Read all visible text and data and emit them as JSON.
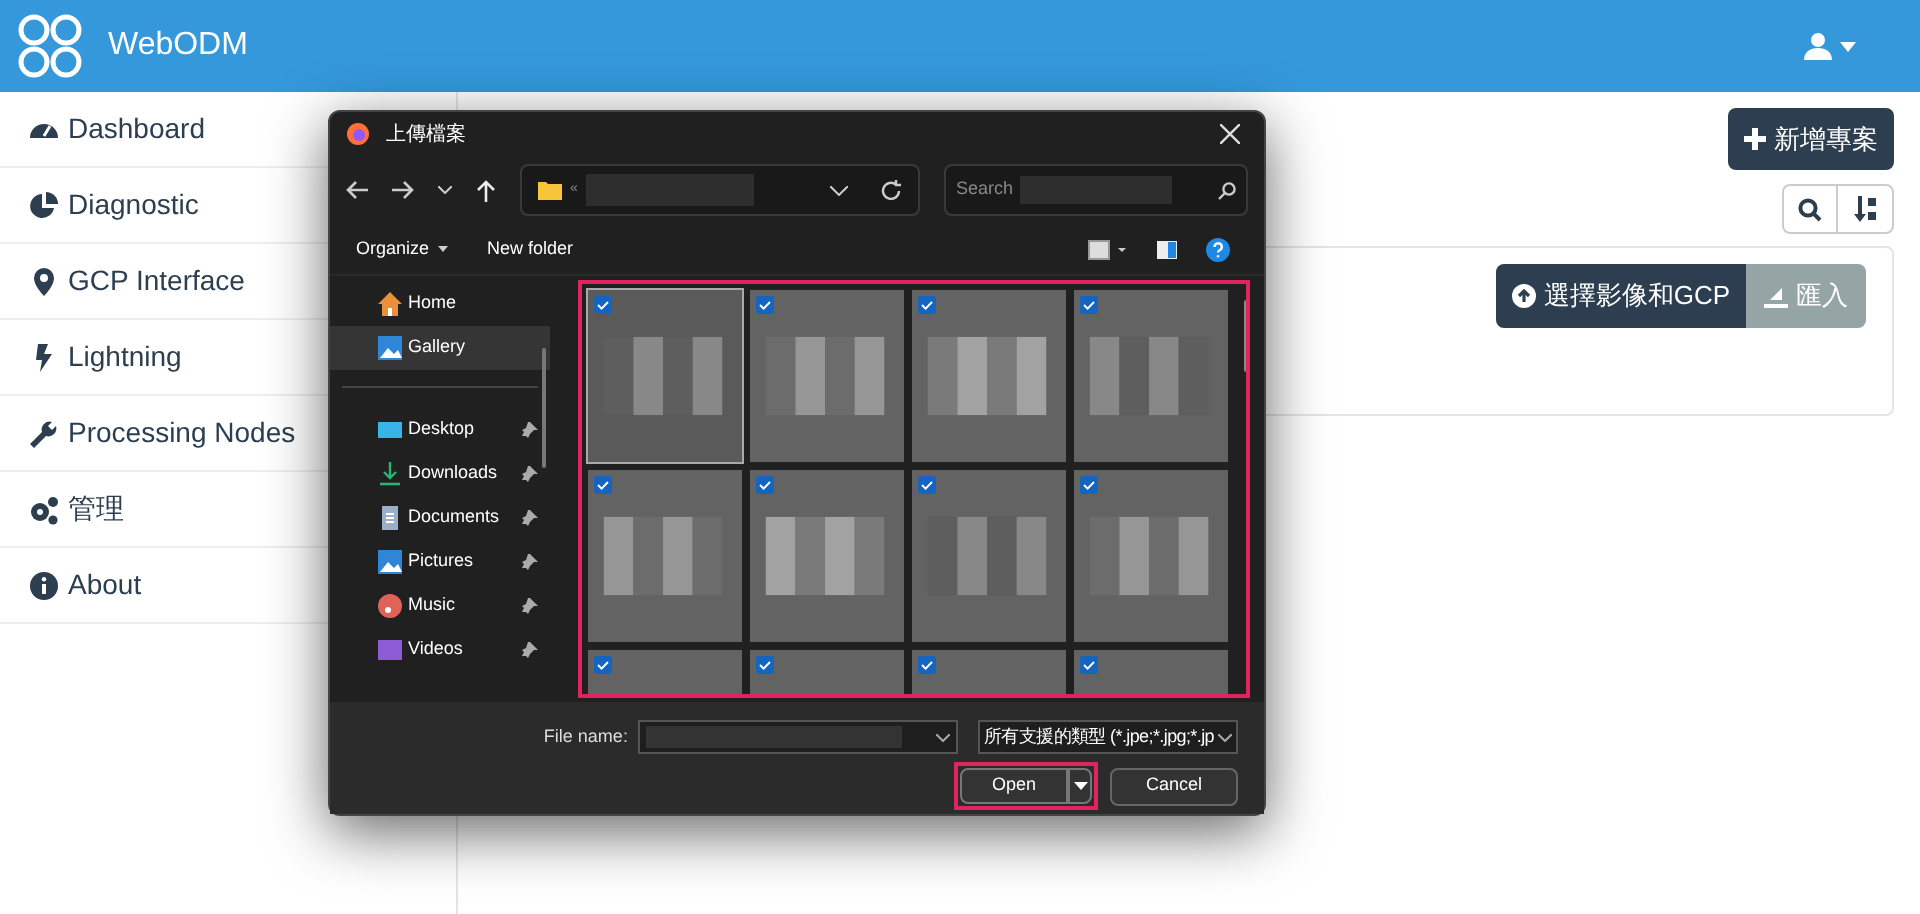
{
  "app": {
    "title": "WebODM"
  },
  "sidebar": {
    "items": [
      {
        "label": "Dashboard",
        "kind": "dashboard"
      },
      {
        "label": "Diagnostic",
        "kind": "pie"
      },
      {
        "label": "GCP Interface",
        "kind": "pin"
      },
      {
        "label": "Lightning",
        "kind": "bolt"
      },
      {
        "label": "Processing Nodes",
        "kind": "wrench"
      },
      {
        "label": "管理",
        "kind": "gears"
      },
      {
        "label": "About",
        "kind": "info"
      }
    ]
  },
  "toolbar": {
    "new_project": "新增專案"
  },
  "project": {
    "select_button": "選擇影像和GCP",
    "import_button": "匯入"
  },
  "dialog": {
    "title": "上傳檔案",
    "address_prefix": "«",
    "search_placeholder": "Search",
    "organize": "Organize",
    "new_folder": "New folder",
    "nav": [
      {
        "label": "Home",
        "kind": "home",
        "selected": false,
        "pinned": false
      },
      {
        "label": "Gallery",
        "kind": "gallery",
        "selected": true,
        "pinned": false
      },
      {
        "kind": "divider"
      },
      {
        "label": "Desktop",
        "kind": "desktop",
        "selected": false,
        "pinned": true
      },
      {
        "label": "Downloads",
        "kind": "download",
        "selected": false,
        "pinned": true
      },
      {
        "label": "Documents",
        "kind": "documents",
        "selected": false,
        "pinned": true
      },
      {
        "label": "Pictures",
        "kind": "pictures",
        "selected": false,
        "pinned": true
      },
      {
        "label": "Music",
        "kind": "music",
        "selected": false,
        "pinned": true
      },
      {
        "label": "Videos",
        "kind": "videos",
        "selected": false,
        "pinned": true
      }
    ],
    "thumbnails": [
      {
        "checked": true,
        "selected": true
      },
      {
        "checked": true,
        "selected": false
      },
      {
        "checked": true,
        "selected": false
      },
      {
        "checked": true,
        "selected": false
      },
      {
        "checked": true,
        "selected": false
      },
      {
        "checked": true,
        "selected": false
      },
      {
        "checked": true,
        "selected": false
      },
      {
        "checked": true,
        "selected": false
      },
      {
        "checked": true,
        "selected": false
      },
      {
        "checked": true,
        "selected": false
      },
      {
        "checked": true,
        "selected": false
      },
      {
        "checked": true,
        "selected": false
      }
    ],
    "file_name_label": "File name:",
    "file_type": "所有支援的類型 (*.jpe;*.jpg;*.jp",
    "open": "Open",
    "cancel": "Cancel"
  }
}
